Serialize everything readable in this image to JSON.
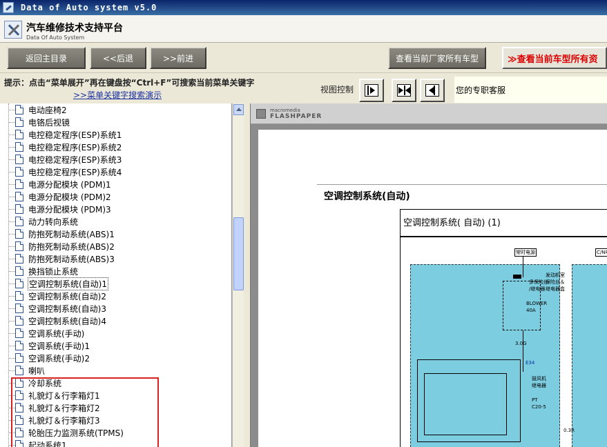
{
  "window": {
    "title": "Data of Auto system v5.0"
  },
  "header": {
    "title": "汽车维修技术支持平台",
    "subtitle": "Data Of Auto System"
  },
  "toolbar": {
    "home": "返回主目录",
    "back": "<<后退",
    "forward": ">>前进",
    "maker_models": "查看当前厂家所有车型",
    "all_models": "≫查看当前车型所有资"
  },
  "hint": {
    "text": "提示：点击“菜单展开”再在键盘按“Ctrl+F”可搜索当前菜单关键字",
    "link": ">>菜单关键字搜索演示",
    "view_control": "视图控制"
  },
  "service": {
    "text": "您的专职客服"
  },
  "tree": {
    "items": [
      "电动座椅2",
      "电铬后视镜",
      "电控稳定程序(ESP)系统1",
      "电控稳定程序(ESP)系统2",
      "电控稳定程序(ESP)系统3",
      "电控稳定程序(ESP)系统4",
      "电源分配模块 (PDM)1",
      "电源分配模块 (PDM)2",
      "电源分配模块 (PDM)3",
      "动力转向系统",
      "防抱死制动系统(ABS)1",
      "防抱死制动系统(ABS)2",
      "防抱死制动系统(ABS)3",
      "换挡锁止系统",
      "空调控制系统(自动)1",
      "空调控制系统(自动)2",
      "空调控制系统(自动)3",
      "空调控制系统(自动)4",
      "空调系统(手动)",
      "空调系统(手动)1",
      "空调系统(手动)2",
      "喇叭",
      "冷却系统",
      "礼貌灯＆行李箱灯1",
      "礼貌灯＆行李箱灯2",
      "礼貌灯＆行李箱灯3",
      "轮胎压力监测系统(TPMS)",
      "起动系统1"
    ],
    "selected": "空调控制系统(自动)1"
  },
  "viewer": {
    "brand_top": "macromedia",
    "brand_bottom": "FLASHPAPER",
    "doc_title": "空调控制系统(自动)",
    "diagram_title": "空调控制系统( 自动) (1)",
    "labels": {
      "l1": "常时电源",
      "l2": "C/N电",
      "l3": "BLOWER",
      "l4": "40A",
      "l5": "3.0G",
      "l6": "E34",
      "l7": "鼓风机",
      "l8": "继电器",
      "l9": "PT",
      "l10": "C20-5",
      "l11": "0.3R",
      "l12": "多保险丝",
      "l13": "/继电器",
      "l14": "发动机室",
      "l15": "保险丝＆",
      "l16": "继电器盒"
    }
  },
  "colors": {
    "diagram_panel": "#7dcde0",
    "highlight_box": "#d92020"
  }
}
